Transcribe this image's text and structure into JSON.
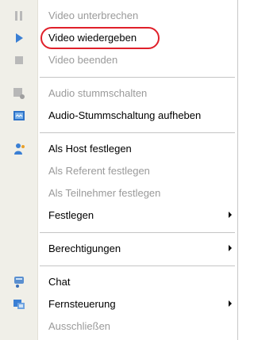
{
  "menu": {
    "items": [
      {
        "label": "Video unterbrechen",
        "icon": "pause-icon",
        "enabled": false
      },
      {
        "label": "Video wiedergeben",
        "icon": "play-icon",
        "enabled": true
      },
      {
        "label": "Video beenden",
        "icon": "stop-icon",
        "enabled": false
      },
      {
        "label": "Audio stummschalten",
        "icon": "mute-icon",
        "enabled": false
      },
      {
        "label": "Audio-Stummschaltung aufheben",
        "icon": "unmute-icon",
        "enabled": true
      },
      {
        "label": "Als Host festlegen",
        "icon": "host-icon",
        "enabled": true
      },
      {
        "label": "Als Referent festlegen",
        "icon": "",
        "enabled": false
      },
      {
        "label": "Als Teilnehmer festlegen",
        "icon": "",
        "enabled": false
      },
      {
        "label": "Festlegen",
        "icon": "",
        "enabled": true,
        "submenu": true
      },
      {
        "label": "Berechtigungen",
        "icon": "",
        "enabled": true,
        "submenu": true
      },
      {
        "label": "Chat",
        "icon": "chat-icon",
        "enabled": true
      },
      {
        "label": "Fernsteuerung",
        "icon": "remote-control-icon",
        "enabled": true,
        "submenu": true
      },
      {
        "label": "Ausschließen",
        "icon": "",
        "enabled": false
      }
    ]
  },
  "colors": {
    "highlight_ring": "#e0202a",
    "disabled_text": "#9a9a9a",
    "accent_blue": "#3a7fd4"
  }
}
